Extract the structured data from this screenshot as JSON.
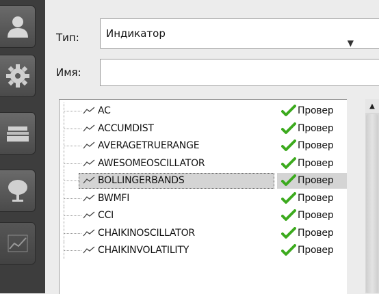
{
  "form": {
    "type_label": "Тип:",
    "type_value": "Индикатор",
    "name_label": "Имя:",
    "name_value": ""
  },
  "sidebar": {
    "buttons": [
      {
        "icon": "user-icon"
      },
      {
        "icon": "gear-icon"
      },
      {
        "icon": "inbox-tray-icon"
      },
      {
        "icon": "tree-icon"
      },
      {
        "icon": "chart-icon"
      }
    ]
  },
  "indicators": [
    {
      "name": "AC",
      "status": "Провер"
    },
    {
      "name": "ACCUMDIST",
      "status": "Провер"
    },
    {
      "name": "AVERAGETRUERANGE",
      "status": "Провер"
    },
    {
      "name": "AWESOMEOSCILLATOR",
      "status": "Провер"
    },
    {
      "name": "BOLLINGERBANDS",
      "status": "Провер",
      "selected": true
    },
    {
      "name": "BWMFI",
      "status": "Провер"
    },
    {
      "name": "CCI",
      "status": "Провер"
    },
    {
      "name": "CHAIKINOSCILLATOR",
      "status": "Провер"
    },
    {
      "name": "CHAIKINVOLATILITY",
      "status": "Провер"
    }
  ],
  "colors": {
    "check": "#3caa1e",
    "sidebar": "#3d3d3d",
    "selection": "#d4d4d4"
  }
}
